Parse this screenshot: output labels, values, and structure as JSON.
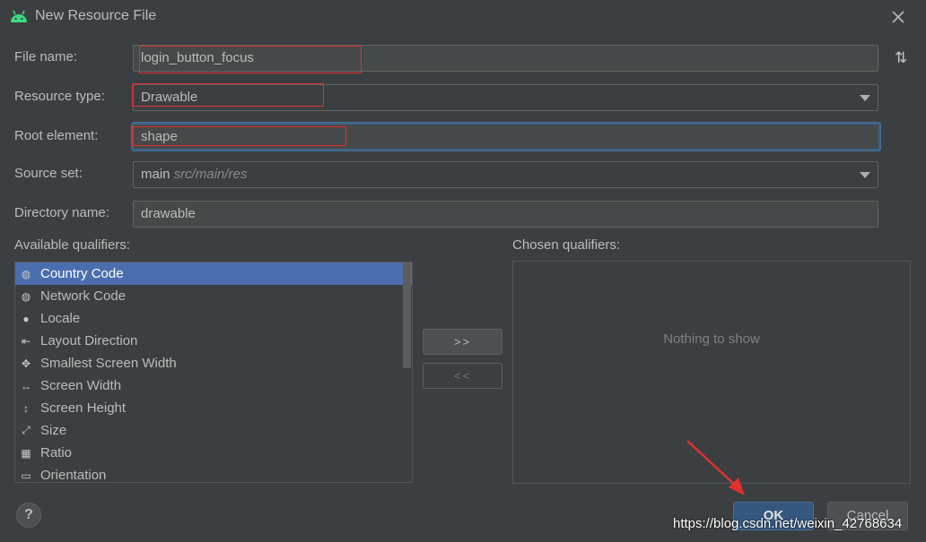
{
  "window": {
    "title": "New Resource File"
  },
  "fields": {
    "file_name": {
      "label": "File name:",
      "value": "login_button_focus"
    },
    "resource_type": {
      "label": "Resource type:",
      "value": "Drawable"
    },
    "root_element": {
      "label": "Root element:",
      "value": "shape"
    },
    "source_set": {
      "label": "Source set:",
      "value": "main",
      "hint": "src/main/res"
    },
    "directory_name": {
      "label": "Directory name:",
      "value": "drawable"
    }
  },
  "available": {
    "label": "Available qualifiers:",
    "items": [
      {
        "label": "Country Code",
        "icon": "country-code-icon"
      },
      {
        "label": "Network Code",
        "icon": "network-code-icon"
      },
      {
        "label": "Locale",
        "icon": "globe-icon"
      },
      {
        "label": "Layout Direction",
        "icon": "layout-direction-icon"
      },
      {
        "label": "Smallest Screen Width",
        "icon": "smallest-width-icon"
      },
      {
        "label": "Screen Width",
        "icon": "screen-width-icon"
      },
      {
        "label": "Screen Height",
        "icon": "screen-height-icon"
      },
      {
        "label": "Size",
        "icon": "size-icon"
      },
      {
        "label": "Ratio",
        "icon": "ratio-icon"
      },
      {
        "label": "Orientation",
        "icon": "orientation-icon"
      }
    ],
    "selected_index": 0
  },
  "chosen": {
    "label": "Chosen qualifiers:",
    "empty_text": "Nothing to show"
  },
  "move_buttons": {
    "add": ">>",
    "remove": "<<"
  },
  "footer": {
    "help": "?",
    "ok": "OK",
    "cancel": "Cancel"
  },
  "watermark": "https://blog.csdn.net/weixin_42768634",
  "colors": {
    "background": "#3c3f41",
    "selection": "#4b6eaf",
    "ok_button": "#365880",
    "annotation": "#e03030",
    "android_green": "#3ddc84"
  }
}
